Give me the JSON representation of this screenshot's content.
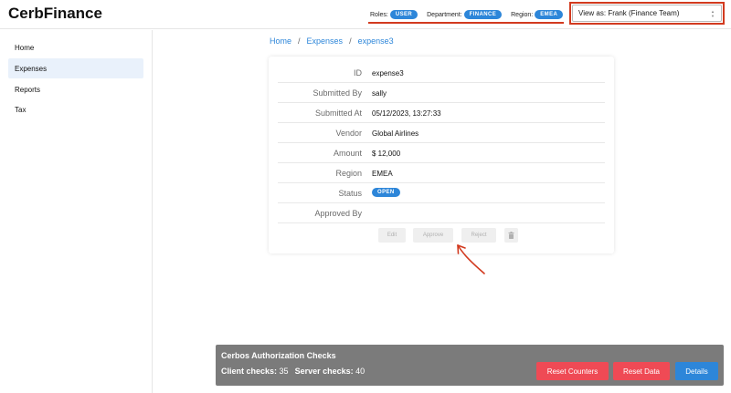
{
  "app": {
    "brand": "CerbFinance"
  },
  "header": {
    "roles_label": "Roles:",
    "roles_value": "USER",
    "department_label": "Department:",
    "department_value": "FINANCE",
    "region_label": "Region:",
    "region_value": "EMEA",
    "view_as": "View as: Frank (Finance Team)",
    "view_as_chevron_up": "▲",
    "view_as_chevron_down": "▼"
  },
  "sidebar": {
    "items": [
      {
        "label": "Home"
      },
      {
        "label": "Expenses",
        "active": true
      },
      {
        "label": "Reports"
      },
      {
        "label": "Tax"
      }
    ]
  },
  "breadcrumb": {
    "home": "Home",
    "expenses": "Expenses",
    "current": "expense3",
    "separator": "/"
  },
  "details": {
    "rows": [
      {
        "key": "ID",
        "value": "expense3"
      },
      {
        "key": "Submitted By",
        "value": "sally"
      },
      {
        "key": "Submitted At",
        "value": "05/12/2023, 13:27:33"
      },
      {
        "key": "Vendor",
        "value": "Global Airlines"
      },
      {
        "key": "Amount",
        "value": "$ 12,000"
      },
      {
        "key": "Region",
        "value": "EMEA"
      },
      {
        "key": "Status",
        "value": "OPEN"
      },
      {
        "key": "Approved By",
        "value": ""
      }
    ]
  },
  "actions": {
    "edit": "Edit",
    "approve": "Approve",
    "reject": "Reject",
    "delete_icon": "trash-icon"
  },
  "cerbos": {
    "title": "Cerbos Authorization Checks",
    "client_label": "Client checks:",
    "client_value": "35",
    "server_label": "Server checks:",
    "server_value": "40",
    "reset_counters": "Reset Counters",
    "reset_data": "Reset Data",
    "details": "Details"
  },
  "colors": {
    "accent": "#2d86d9",
    "highlight": "#d23a1f",
    "danger": "#ef4a55",
    "panel": "#7b7b7b"
  }
}
